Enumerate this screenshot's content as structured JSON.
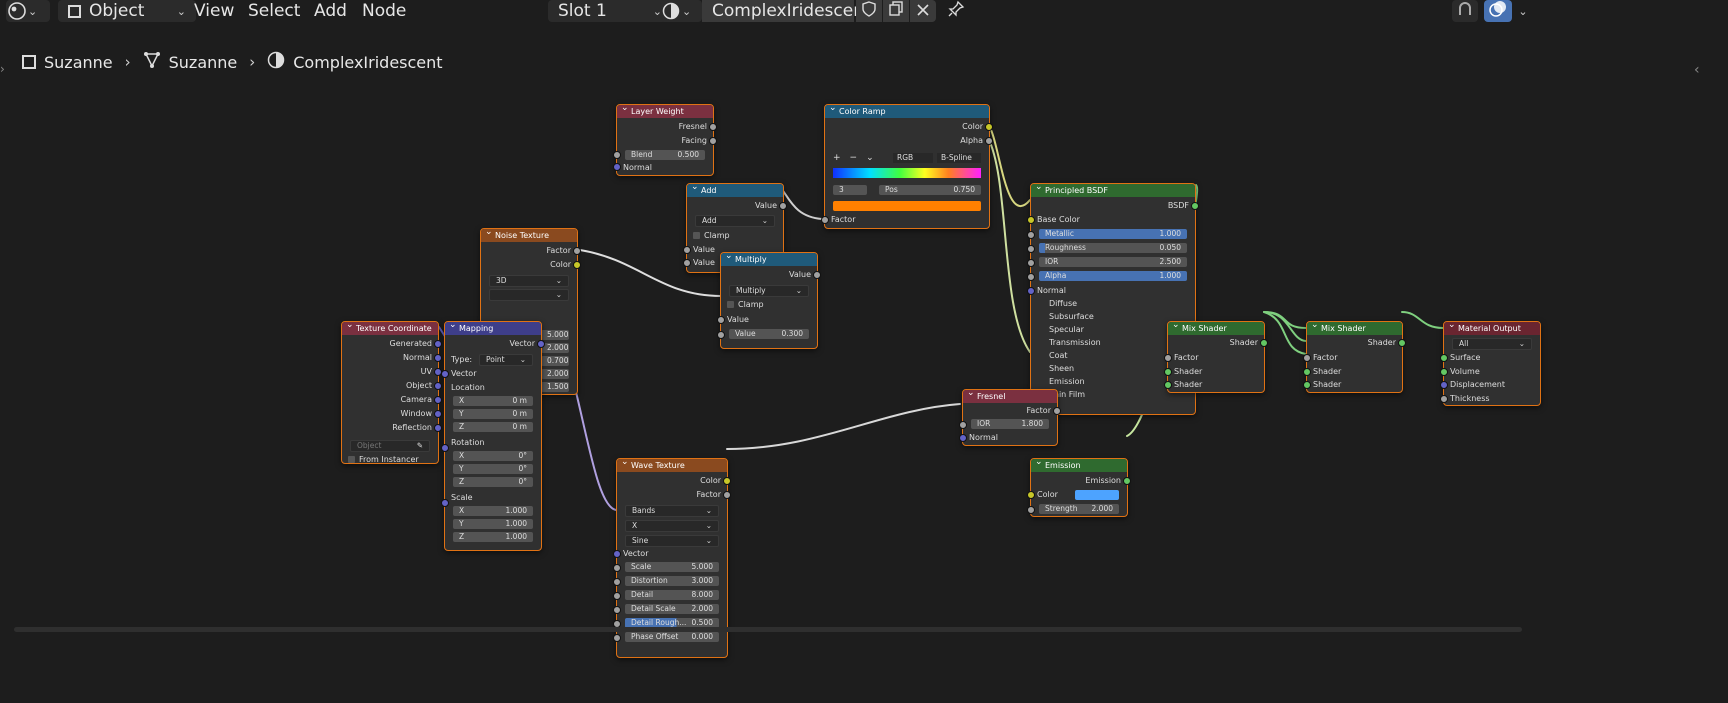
{
  "header": {
    "mode_dropdown": "Object",
    "menus": [
      "View",
      "Select",
      "Add",
      "Node"
    ],
    "slot": "Slot 1",
    "material_name": "ComplexIridescent"
  },
  "breadcrumb": {
    "object": "Suzanne",
    "mesh": "Suzanne",
    "material": "ComplexIridescent"
  },
  "colors": {
    "accent_blue": "#4772b3",
    "node_border": "#e07214",
    "emission_color": "#4da3ff",
    "ramp_output": "#ff8000"
  },
  "nodes": {
    "layer_weight": {
      "title": "Layer Weight",
      "out_fresnel": "Fresnel",
      "out_facing": "Facing",
      "blend_label": "Blend",
      "blend_value": "0.500",
      "in_normal": "Normal"
    },
    "add": {
      "title": "Add",
      "out_value": "Value",
      "operation": "Add",
      "clamp": "Clamp",
      "in_value1": "Value",
      "in_value2": "Value"
    },
    "multiply": {
      "title": "Multiply",
      "out_value": "Value",
      "operation": "Multiply",
      "clamp": "Clamp",
      "in_value": "Value",
      "value_label": "Value",
      "value": "0.300"
    },
    "color_ramp": {
      "title": "Color Ramp",
      "out_color": "Color",
      "out_alpha": "Alpha",
      "color_mode": "RGB",
      "interpolation": "B-Spline",
      "stop_index": "3",
      "pos_label": "Pos",
      "pos_value": "0.750",
      "in_factor": "Factor"
    },
    "noise": {
      "title": "Noise Texture",
      "out_factor": "Factor",
      "out_color": "Color",
      "dimensions": "3D",
      "hidden_values": [
        "5.000",
        "2.000",
        "0.700",
        "2.000",
        "1.500"
      ]
    },
    "tex_coord": {
      "title": "Texture Coordinate",
      "outputs": [
        "Generated",
        "Normal",
        "UV",
        "Object",
        "Camera",
        "Window",
        "Reflection"
      ],
      "object_placeholder": "Object",
      "from_instancer": "From Instancer"
    },
    "mapping": {
      "title": "Mapping",
      "out_vector": "Vector",
      "type_label": "Type:",
      "type_value": "Point",
      "in_vector": "Vector",
      "location": "Location",
      "loc_x": "0 m",
      "loc_y": "0 m",
      "loc_z": "0 m",
      "rotation": "Rotation",
      "rot_x": "0°",
      "rot_y": "0°",
      "rot_z": "0°",
      "scale": "Scale",
      "scl_x": "1.000",
      "scl_y": "1.000",
      "scl_z": "1.000",
      "axis_x": "X",
      "axis_y": "Y",
      "axis_z": "Z"
    },
    "wave": {
      "title": "Wave Texture",
      "out_color": "Color",
      "out_factor": "Factor",
      "wave_type": "Bands",
      "direction": "X",
      "profile": "Sine",
      "in_vector": "Vector",
      "params": [
        {
          "label": "Scale",
          "value": "5.000"
        },
        {
          "label": "Distortion",
          "value": "3.000"
        },
        {
          "label": "Detail",
          "value": "8.000"
        },
        {
          "label": "Detail Scale",
          "value": "2.000"
        },
        {
          "label": "Detail Rough...",
          "value": "0.500"
        },
        {
          "label": "Phase Offset",
          "value": "0.000"
        }
      ]
    },
    "principled": {
      "title": "Principled BSDF",
      "out_bsdf": "BSDF",
      "base_color": "Base Color",
      "params": [
        {
          "label": "Metallic",
          "value": "1.000"
        },
        {
          "label": "Roughness",
          "value": "0.050"
        },
        {
          "label": "IOR",
          "value": "2.500"
        },
        {
          "label": "Alpha",
          "value": "1.000"
        }
      ],
      "normal": "Normal",
      "panels": [
        "Diffuse",
        "Subsurface",
        "Specular",
        "Transmission",
        "Coat",
        "Sheen",
        "Emission",
        "Thin Film"
      ]
    },
    "fresnel": {
      "title": "Fresnel",
      "out_factor": "Factor",
      "ior_label": "IOR",
      "ior_value": "1.800",
      "in_normal": "Normal"
    },
    "emission": {
      "title": "Emission",
      "out_emission": "Emission",
      "color_label": "Color",
      "strength_label": "Strength",
      "strength_value": "2.000"
    },
    "mix1": {
      "title": "Mix Shader",
      "out_shader": "Shader",
      "in_factor": "Factor",
      "in_shader1": "Shader",
      "in_shader2": "Shader"
    },
    "mix2": {
      "title": "Mix Shader",
      "out_shader": "Shader",
      "in_factor": "Factor",
      "in_shader1": "Shader",
      "in_shader2": "Shader"
    },
    "output": {
      "title": "Material Output",
      "target": "All",
      "in_surface": "Surface",
      "in_volume": "Volume",
      "in_displacement": "Displacement",
      "in_thickness": "Thickness"
    }
  }
}
